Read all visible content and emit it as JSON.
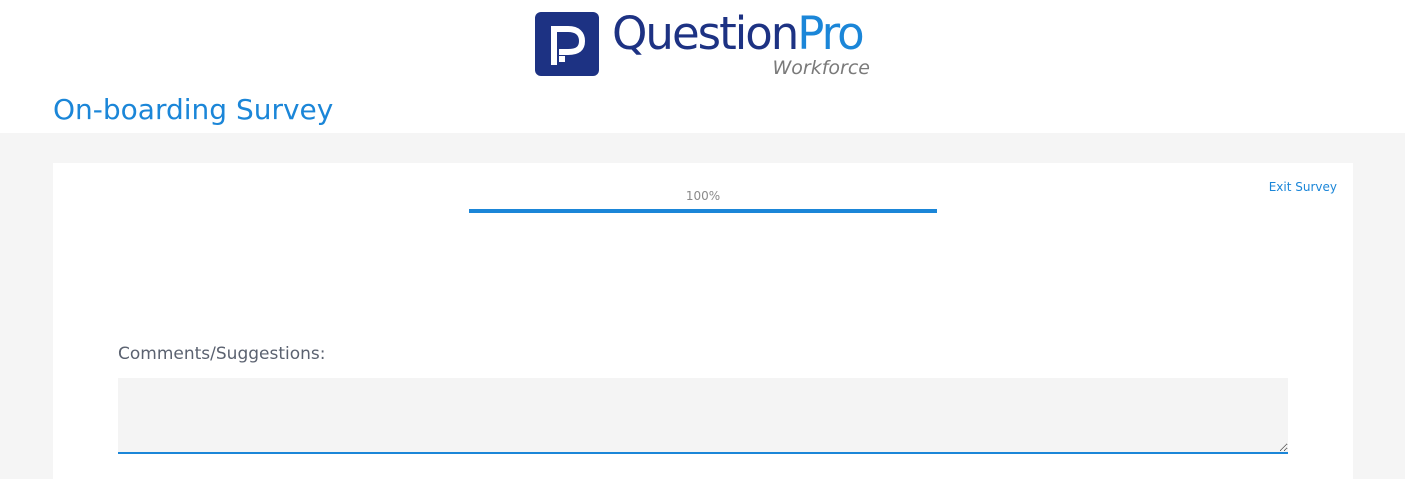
{
  "logo": {
    "brand_main": "Question",
    "brand_accent": "Pro",
    "brand_sub": "Workforce",
    "icon": "questionpro-p-icon"
  },
  "survey": {
    "title": "On-boarding Survey",
    "exit_label": "Exit Survey"
  },
  "progress": {
    "label": "100%",
    "fraction": 1.0
  },
  "question": {
    "label": "Comments/Suggestions:",
    "value": "",
    "placeholder": ""
  },
  "colors": {
    "brand_navy": "#1d3283",
    "accent_blue": "#1b86d8",
    "background_gray": "#f5f5f5"
  }
}
